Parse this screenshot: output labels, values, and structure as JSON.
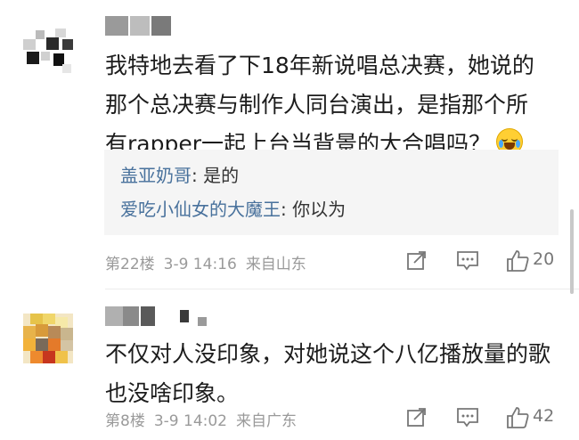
{
  "comments": [
    {
      "body_line1": "我特地去看了下18年新说唱总决赛，她说的",
      "body_line2": "那个总决赛与制作人同台演出，是指那个所",
      "body_line3": "有rapper一起上台当背景的大合唱吗？",
      "emoji": "laugh-cry-emoji",
      "replies": [
        {
          "name": "盖亚奶哥",
          "sep": ": ",
          "text": "是的"
        },
        {
          "name": "爱吃小仙女的大魔王",
          "sep": ": ",
          "text": "你以为"
        }
      ],
      "floor": "第22楼",
      "time": "3-9 14:16",
      "source": "来自山东",
      "likes": "20"
    },
    {
      "body_line1": "不仅对人没印象，对她说这个八亿播放量的歌",
      "body_line2": "也没啥印象。",
      "floor": "第8楼",
      "time": "3-9 14:02",
      "source": "来自广东",
      "likes": "42"
    }
  ],
  "icons": {
    "share": "share-icon",
    "reply": "comment-icon",
    "like": "thumbs-up-icon"
  },
  "colors": {
    "text": "#1c1c1c",
    "meta": "#9a9a9a",
    "reply_name": "#48719c",
    "reply_bg": "#f5f5f5"
  }
}
